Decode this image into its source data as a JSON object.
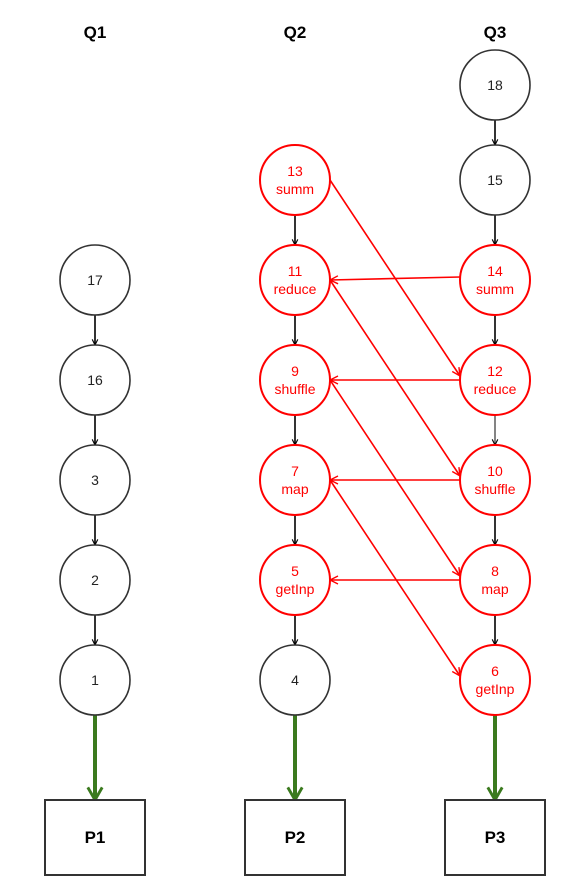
{
  "colors": {
    "normal_stroke": "#333333",
    "normal_text": "#222222",
    "highlight": "#ff0000",
    "edge_black": "#000000",
    "edge_gray": "#666666",
    "edge_green": "#3b7a1e"
  },
  "columns": [
    {
      "id": "Q1",
      "label": "Q1"
    },
    {
      "id": "Q2",
      "label": "Q2"
    },
    {
      "id": "Q3",
      "label": "Q3"
    }
  ],
  "nodes": [
    {
      "id": "17",
      "col": "Q1",
      "row": 2,
      "lines": [
        "17"
      ],
      "highlight": false
    },
    {
      "id": "16",
      "col": "Q1",
      "row": 3,
      "lines": [
        "16"
      ],
      "highlight": false
    },
    {
      "id": "3",
      "col": "Q1",
      "row": 4,
      "lines": [
        "3"
      ],
      "highlight": false
    },
    {
      "id": "2",
      "col": "Q1",
      "row": 5,
      "lines": [
        "2"
      ],
      "highlight": false
    },
    {
      "id": "1",
      "col": "Q1",
      "row": 6,
      "lines": [
        "1"
      ],
      "highlight": false
    },
    {
      "id": "13",
      "col": "Q2",
      "row": 1,
      "lines": [
        "13",
        "summ"
      ],
      "highlight": true
    },
    {
      "id": "11",
      "col": "Q2",
      "row": 2,
      "lines": [
        "11",
        "reduce"
      ],
      "highlight": true
    },
    {
      "id": "9",
      "col": "Q2",
      "row": 3,
      "lines": [
        "9",
        "shuffle"
      ],
      "highlight": true
    },
    {
      "id": "7",
      "col": "Q2",
      "row": 4,
      "lines": [
        "7",
        "map"
      ],
      "highlight": true
    },
    {
      "id": "5",
      "col": "Q2",
      "row": 5,
      "lines": [
        "5",
        "getInp"
      ],
      "highlight": true
    },
    {
      "id": "4",
      "col": "Q2",
      "row": 6,
      "lines": [
        "4"
      ],
      "highlight": false
    },
    {
      "id": "18",
      "col": "Q3",
      "row": 0,
      "lines": [
        "18"
      ],
      "highlight": false
    },
    {
      "id": "15",
      "col": "Q3",
      "row": 1,
      "lines": [
        "15"
      ],
      "highlight": false
    },
    {
      "id": "14",
      "col": "Q3",
      "row": 2,
      "lines": [
        "14",
        "summ"
      ],
      "highlight": true
    },
    {
      "id": "12",
      "col": "Q3",
      "row": 3,
      "lines": [
        "12",
        "reduce"
      ],
      "highlight": true
    },
    {
      "id": "10",
      "col": "Q3",
      "row": 4,
      "lines": [
        "10",
        "shuffle"
      ],
      "highlight": true
    },
    {
      "id": "8",
      "col": "Q3",
      "row": 5,
      "lines": [
        "8",
        "map"
      ],
      "highlight": true
    },
    {
      "id": "6",
      "col": "Q3",
      "row": 6,
      "lines": [
        "6",
        "getInp"
      ],
      "highlight": true
    }
  ],
  "processors": [
    {
      "id": "P1",
      "col": "Q1",
      "label": "P1"
    },
    {
      "id": "P2",
      "col": "Q2",
      "label": "P2"
    },
    {
      "id": "P3",
      "col": "Q3",
      "label": "P3"
    }
  ],
  "edges": [
    {
      "from": "17",
      "to": "16",
      "kind": "black"
    },
    {
      "from": "16",
      "to": "3",
      "kind": "black"
    },
    {
      "from": "3",
      "to": "2",
      "kind": "black"
    },
    {
      "from": "2",
      "to": "1",
      "kind": "black"
    },
    {
      "from": "13",
      "to": "11",
      "kind": "black"
    },
    {
      "from": "11",
      "to": "9",
      "kind": "black"
    },
    {
      "from": "9",
      "to": "7",
      "kind": "black"
    },
    {
      "from": "7",
      "to": "5",
      "kind": "black"
    },
    {
      "from": "5",
      "to": "4",
      "kind": "black"
    },
    {
      "from": "18",
      "to": "15",
      "kind": "black"
    },
    {
      "from": "15",
      "to": "14",
      "kind": "black"
    },
    {
      "from": "14",
      "to": "12",
      "kind": "black"
    },
    {
      "from": "12",
      "to": "10",
      "kind": "gray"
    },
    {
      "from": "10",
      "to": "8",
      "kind": "black"
    },
    {
      "from": "8",
      "to": "6",
      "kind": "black"
    },
    {
      "from": "14",
      "to": "11",
      "kind": "red"
    },
    {
      "from": "12",
      "to": "9",
      "kind": "red"
    },
    {
      "from": "10",
      "to": "7",
      "kind": "red"
    },
    {
      "from": "8",
      "to": "5",
      "kind": "red"
    },
    {
      "from": "13",
      "to": "12",
      "kind": "red"
    },
    {
      "from": "11",
      "to": "10",
      "kind": "red"
    },
    {
      "from": "9",
      "to": "8",
      "kind": "red"
    },
    {
      "from": "7",
      "to": "6",
      "kind": "red"
    },
    {
      "from": "1",
      "to": "P1",
      "kind": "green"
    },
    {
      "from": "4",
      "to": "P2",
      "kind": "green"
    },
    {
      "from": "6",
      "to": "P3",
      "kind": "green"
    }
  ]
}
